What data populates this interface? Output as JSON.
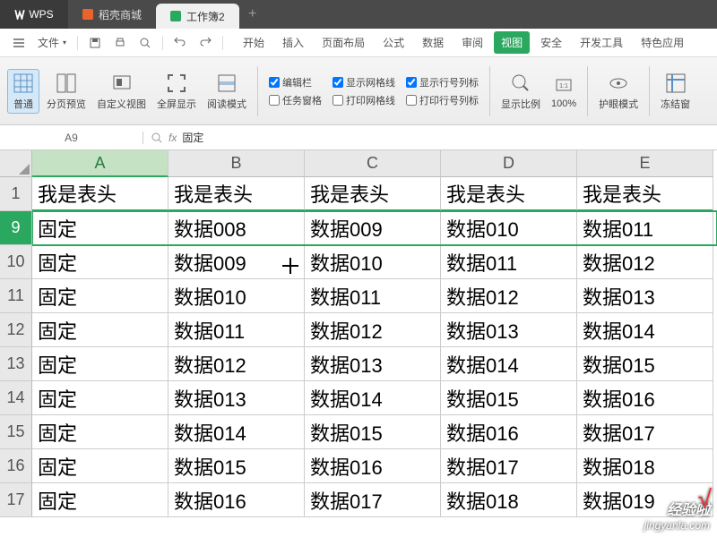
{
  "titlebar": {
    "logo": "WPS",
    "tab_store": "稻壳商城",
    "tab_active": "工作簿2",
    "plus": "+"
  },
  "menubar": {
    "file": "文件",
    "tabs": [
      "开始",
      "插入",
      "页面布局",
      "公式",
      "数据",
      "审阅",
      "视图",
      "安全",
      "开发工具",
      "特色应用"
    ],
    "active_tab": "视图"
  },
  "ribbon": {
    "normal": "普通",
    "pagebreak": "分页预览",
    "custom": "自定义视图",
    "fullscreen": "全屏显示",
    "read": "阅读模式",
    "chk_editbar": "编辑栏",
    "chk_taskpane": "任务窗格",
    "chk_gridlines": "显示网格线",
    "chk_printgrid": "打印网格线",
    "chk_headings": "显示行号列标",
    "chk_printhead": "打印行号列标",
    "zoom": "显示比例",
    "hundred": "100%",
    "eyecare": "护眼模式",
    "freeze": "冻结窗"
  },
  "fxbar": {
    "name": "A9",
    "fx": "fx",
    "value": "固定"
  },
  "sheet": {
    "cols": [
      "A",
      "B",
      "C",
      "D",
      "E"
    ],
    "row_nums": [
      "1",
      "9",
      "10",
      "11",
      "12",
      "13",
      "14",
      "15",
      "16",
      "17"
    ],
    "selected_row_idx": 1,
    "rows": [
      [
        "我是表头",
        "我是表头",
        "我是表头",
        "我是表头",
        "我是表头"
      ],
      [
        "固定",
        "数据008",
        "数据009",
        "数据010",
        "数据011"
      ],
      [
        "固定",
        "数据009",
        "数据010",
        "数据011",
        "数据012"
      ],
      [
        "固定",
        "数据010",
        "数据011",
        "数据012",
        "数据013"
      ],
      [
        "固定",
        "数据011",
        "数据012",
        "数据013",
        "数据014"
      ],
      [
        "固定",
        "数据012",
        "数据013",
        "数据014",
        "数据015"
      ],
      [
        "固定",
        "数据013",
        "数据014",
        "数据015",
        "数据016"
      ],
      [
        "固定",
        "数据014",
        "数据015",
        "数据016",
        "数据017"
      ],
      [
        "固定",
        "数据015",
        "数据016",
        "数据017",
        "数据018"
      ],
      [
        "固定",
        "数据016",
        "数据017",
        "数据018",
        "数据019"
      ]
    ]
  },
  "watermark": {
    "l1": "经验啦",
    "l2": "jingyanla.com",
    "mark": "√"
  }
}
